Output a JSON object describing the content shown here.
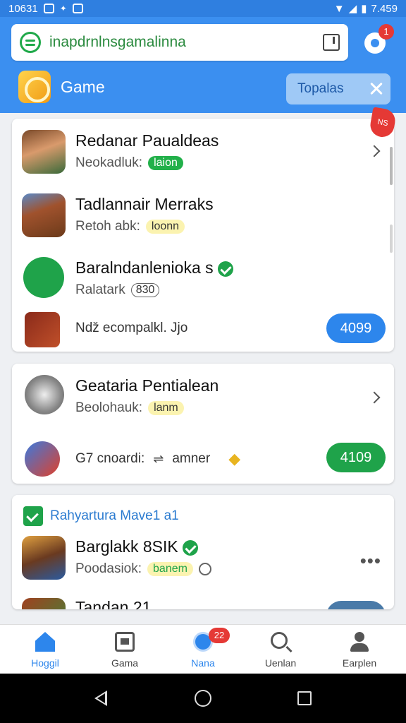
{
  "status_bar": {
    "time_left": "10631",
    "time_right": "7.459"
  },
  "header": {
    "search_text": "inapdrnlnsgamalinna",
    "notification_count": "1",
    "game_label": "Game",
    "chip_label": "Topalas"
  },
  "flag_text": "NS",
  "card1": {
    "rows": [
      {
        "title": "Redanar Paualdeas",
        "sub": "Neokadluk:",
        "badge": "laion"
      },
      {
        "title": "Tadlannair Merraks",
        "sub": "Retoh abk:",
        "badge": "loonn"
      },
      {
        "title": "Baralndanlenioka s",
        "sub": "Ralatark",
        "badge": "830"
      },
      {
        "title": "Nǆ ecompalkl. Jjo",
        "button": "4099"
      }
    ]
  },
  "card2": {
    "rows": [
      {
        "title": "Geataria Pentialean",
        "sub": "Beolohauk:",
        "badge": "lanm"
      },
      {
        "title": "G7 cnoardi:",
        "extra": "amner",
        "button": "4109"
      }
    ]
  },
  "card3": {
    "section_title": "Rahyartura Mave1 a1",
    "rows": [
      {
        "title": "Barglakk 8SIK",
        "sub": "Poodasiok:",
        "badge": "banem"
      },
      {
        "title": "Tandan 21"
      }
    ]
  },
  "bottom_nav": [
    {
      "label": "Hoggil"
    },
    {
      "label": "Gama"
    },
    {
      "label": "Nana",
      "badge": "22"
    },
    {
      "label": "Uenlan"
    },
    {
      "label": "Earplen"
    }
  ],
  "colors": {
    "accent": "#2d86ec",
    "header": "#3b8ff0",
    "success": "#1fa34a",
    "badge": "#e53935"
  }
}
